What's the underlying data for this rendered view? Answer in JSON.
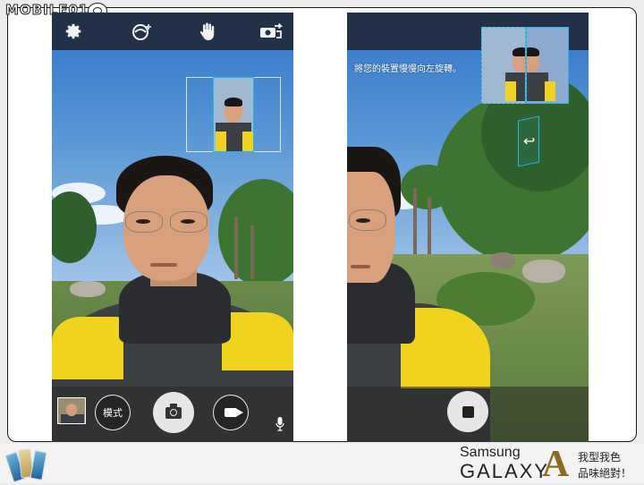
{
  "brand": {
    "site_name": "MOBILE01",
    "logo_icon": "mobile01-logo-icon"
  },
  "left_phone": {
    "topbar_icons": [
      "gear-icon",
      "panorama-mode-icon",
      "hand-icon",
      "switch-camera-icon"
    ],
    "bottom": {
      "mode_label": "模式",
      "shutter_icon": "camera-icon",
      "video_icon": "video-camera-icon",
      "mic_icon": "microphone-icon"
    }
  },
  "right_phone": {
    "hint_text": "將您的裝置慢慢向左旋轉。",
    "stop_icon": "stop-icon"
  },
  "footer": {
    "samsung": "Samsung",
    "galaxy": "GALAXY",
    "a_letter": "A",
    "slogan_line1": "我型我色",
    "slogan_line2": "品味絕對！"
  },
  "colors": {
    "topbar": "#233148",
    "pano_guide": "#26b5e8",
    "jacket_yellow": "#f0d31e"
  }
}
